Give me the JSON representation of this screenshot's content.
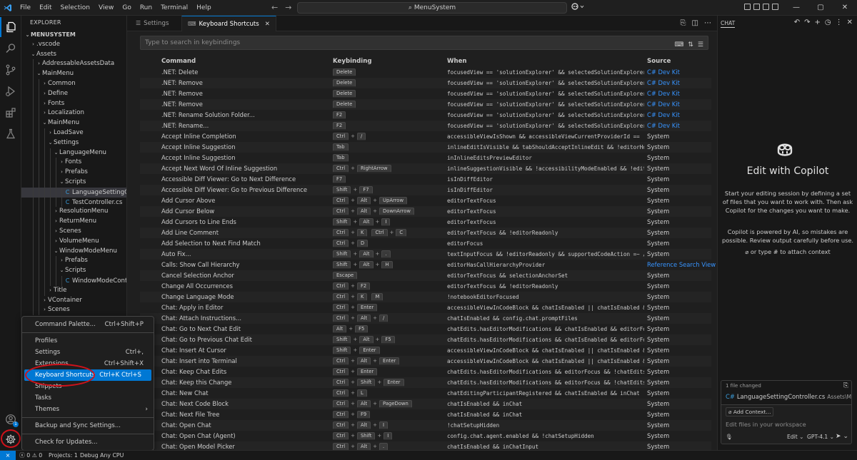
{
  "titlebar": {
    "menus": [
      "File",
      "Edit",
      "Selection",
      "View",
      "Go",
      "Run",
      "Terminal",
      "Help"
    ],
    "search": "MenuSystem",
    "icons": [
      "vscode-logo-icon",
      "back-arrow-icon",
      "forward-arrow-icon",
      "search-icon",
      "copilot-icon",
      "layout-icons",
      "minimize-icon",
      "maximize-icon",
      "close-icon"
    ]
  },
  "explorer": {
    "title": "EXPLORER",
    "tree": [
      {
        "label": "MENUSYSTEM",
        "depth": 0,
        "expanded": true,
        "bold": true
      },
      {
        "label": ".vscode",
        "depth": 1,
        "expanded": false
      },
      {
        "label": "Assets",
        "depth": 1,
        "expanded": true
      },
      {
        "label": "AddressableAssetsData",
        "depth": 2,
        "expanded": false
      },
      {
        "label": "MainMenu",
        "depth": 2,
        "expanded": true
      },
      {
        "label": "Common",
        "depth": 3,
        "expanded": false
      },
      {
        "label": "Define",
        "depth": 3,
        "expanded": false
      },
      {
        "label": "Fonts",
        "depth": 3,
        "expanded": false
      },
      {
        "label": "Localization",
        "depth": 3,
        "expanded": false
      },
      {
        "label": "MainMenu",
        "depth": 3,
        "expanded": true
      },
      {
        "label": "LoadSave",
        "depth": 4,
        "expanded": false
      },
      {
        "label": "Settings",
        "depth": 4,
        "expanded": true
      },
      {
        "label": "LanguageMenu",
        "depth": 5,
        "expanded": true
      },
      {
        "label": "Fonts",
        "depth": 6,
        "expanded": false
      },
      {
        "label": "Prefabs",
        "depth": 6,
        "expanded": false
      },
      {
        "label": "Scripts",
        "depth": 6,
        "expanded": true
      },
      {
        "label": "LanguageSettingControll...",
        "depth": 7,
        "file": true,
        "selected": true
      },
      {
        "label": "TestController.cs",
        "depth": 7,
        "file": true
      },
      {
        "label": "ResolutionMenu",
        "depth": 5,
        "expanded": false
      },
      {
        "label": "ReturnMenu",
        "depth": 5,
        "expanded": false
      },
      {
        "label": "Scenes",
        "depth": 5,
        "expanded": false
      },
      {
        "label": "VolumeMenu",
        "depth": 5,
        "expanded": false
      },
      {
        "label": "WindowModeMenu",
        "depth": 5,
        "expanded": true
      },
      {
        "label": "Prefabs",
        "depth": 6,
        "expanded": false
      },
      {
        "label": "Scripts",
        "depth": 6,
        "expanded": true
      },
      {
        "label": "WindowModeController.cs",
        "depth": 7,
        "file": true
      },
      {
        "label": "Title",
        "depth": 4,
        "expanded": false
      },
      {
        "label": "VContainer",
        "depth": 3,
        "expanded": false
      },
      {
        "label": "Scenes",
        "depth": 3,
        "expanded": false
      }
    ]
  },
  "tabs": {
    "settings": "Settings",
    "keyboard_shortcuts": "Keyboard Shortcuts",
    "close": "✕"
  },
  "keybindings": {
    "search_placeholder": "Type to search in keybindings",
    "headers": {
      "command": "Command",
      "keybinding": "Keybinding",
      "when": "When",
      "source": "Source"
    },
    "rows": [
      {
        "command": ".NET: Delete",
        "keys": [
          [
            "Delete"
          ]
        ],
        "when": "focusedView == 'solutionExplorer' && selectedSolutionExplorerNodeTy...",
        "source": "C# Dev Kit",
        "link": true
      },
      {
        "command": ".NET: Remove",
        "keys": [
          [
            "Delete"
          ]
        ],
        "when": "focusedView == 'solutionExplorer' && selectedSolutionExplorerNodeTy...",
        "source": "C# Dev Kit",
        "link": true
      },
      {
        "command": ".NET: Remove",
        "keys": [
          [
            "Delete"
          ]
        ],
        "when": "focusedView == 'solutionExplorer' && selectedSolutionExplorerNodeTy...",
        "source": "C# Dev Kit",
        "link": true
      },
      {
        "command": ".NET: Remove",
        "keys": [
          [
            "Delete"
          ]
        ],
        "when": "focusedView == 'solutionExplorer' && selectedSolutionExplorerNodeTy...",
        "source": "C# Dev Kit",
        "link": true
      },
      {
        "command": ".NET: Rename Solution Folder...",
        "keys": [
          [
            "F2"
          ]
        ],
        "when": "focusedView == 'solutionExplorer' && selectedSolutionExplorerNodeTy...",
        "source": "C# Dev Kit",
        "link": true
      },
      {
        "command": ".NET: Rename...",
        "keys": [
          [
            "F2"
          ]
        ],
        "when": "focusedView == 'solutionExplorer' && selectedSolutionExplorerNodeTy...",
        "source": "C# Dev Kit",
        "link": true
      },
      {
        "command": "Accept Inline Completion",
        "keys": [
          [
            "Ctrl",
            "/"
          ]
        ],
        "when": "accessibleViewIsShown && accessibleViewCurrentProviderId == 'inline...",
        "source": "System"
      },
      {
        "command": "Accept Inline Suggestion",
        "keys": [
          [
            "Tab"
          ]
        ],
        "when": "inlineEditIsVisible && tabShouldAcceptInlineEdit && !editorHoverFoc...",
        "source": "System"
      },
      {
        "command": "Accept Inline Suggestion",
        "keys": [
          [
            "Tab"
          ]
        ],
        "when": "inInlineEditsPreviewEditor",
        "source": "System"
      },
      {
        "command": "Accept Next Word Of Inline Suggestion",
        "keys": [
          [
            "Ctrl",
            "RightArrow"
          ]
        ],
        "when": "inlineSuggestionVisible && !accessibilityModeEnabled && !editorRead...",
        "source": "System"
      },
      {
        "command": "Accessible Diff Viewer: Go to Next Difference",
        "keys": [
          [
            "F7"
          ]
        ],
        "when": "isInDiffEditor",
        "source": "System"
      },
      {
        "command": "Accessible Diff Viewer: Go to Previous Difference",
        "keys": [
          [
            "Shift",
            "F7"
          ]
        ],
        "when": "isInDiffEditor",
        "source": "System"
      },
      {
        "command": "Add Cursor Above",
        "keys": [
          [
            "Ctrl",
            "Alt",
            "UpArrow"
          ]
        ],
        "when": "editorTextFocus",
        "source": "System"
      },
      {
        "command": "Add Cursor Below",
        "keys": [
          [
            "Ctrl",
            "Alt",
            "DownArrow"
          ]
        ],
        "when": "editorTextFocus",
        "source": "System"
      },
      {
        "command": "Add Cursors to Line Ends",
        "keys": [
          [
            "Shift",
            "Alt",
            "I"
          ]
        ],
        "when": "editorTextFocus",
        "source": "System"
      },
      {
        "command": "Add Line Comment",
        "keys": [
          [
            "Ctrl",
            "K"
          ],
          [
            "Ctrl",
            "C"
          ]
        ],
        "when": "editorTextFocus && !editorReadonly",
        "source": "System"
      },
      {
        "command": "Add Selection to Next Find Match",
        "keys": [
          [
            "Ctrl",
            "D"
          ]
        ],
        "when": "editorFocus",
        "source": "System"
      },
      {
        "command": "Auto Fix...",
        "keys": [
          [
            "Shift",
            "Alt",
            "."
          ]
        ],
        "when": "textInputFocus && !editorReadonly && supportedCodeAction =~ /(\\s|^)...",
        "source": "System"
      },
      {
        "command": "Calls: Show Call Hierarchy",
        "keys": [
          [
            "Shift",
            "Alt",
            "H"
          ]
        ],
        "when": "editorHasCallHierarchyProvider",
        "source": "Reference Search View",
        "link": true
      },
      {
        "command": "Cancel Selection Anchor",
        "keys": [
          [
            "Escape"
          ]
        ],
        "when": "editorTextFocus && selectionAnchorSet",
        "source": "System"
      },
      {
        "command": "Change All Occurrences",
        "keys": [
          [
            "Ctrl",
            "F2"
          ]
        ],
        "when": "editorTextFocus && !editorReadonly",
        "source": "System"
      },
      {
        "command": "Change Language Mode",
        "keys": [
          [
            "Ctrl",
            "K"
          ],
          [
            "M"
          ]
        ],
        "when": "!notebookEditorFocused",
        "source": "System"
      },
      {
        "command": "Chat: Apply in Editor",
        "keys": [
          [
            "Ctrl",
            "Enter"
          ]
        ],
        "when": "accessibleViewInCodeBlock && chatIsEnabled || chatIsEnabled && inCha...",
        "source": "System"
      },
      {
        "command": "Chat: Attach Instructions...",
        "keys": [
          [
            "Ctrl",
            "Alt",
            "/"
          ]
        ],
        "when": "chatIsEnabled && config.chat.promptFiles",
        "source": "System"
      },
      {
        "command": "Chat: Go to Next Chat Edit",
        "keys": [
          [
            "Alt",
            "F5"
          ]
        ],
        "when": "chatEdits.hasEditorModifications && chatIsEnabled && editorFocus && ...",
        "source": "System"
      },
      {
        "command": "Chat: Go to Previous Chat Edit",
        "keys": [
          [
            "Shift",
            "Alt",
            "F5"
          ]
        ],
        "when": "chatEdits.hasEditorModifications && chatIsEnabled && editorFocus && ...",
        "source": "System"
      },
      {
        "command": "Chat: Insert At Cursor",
        "keys": [
          [
            "Shift",
            "Enter"
          ]
        ],
        "when": "accessibleViewInCodeBlock && chatIsEnabled || chatIsEnabled && inCha...",
        "source": "System"
      },
      {
        "command": "Chat: Insert into Terminal",
        "keys": [
          [
            "Ctrl",
            "Alt",
            "Enter"
          ]
        ],
        "when": "accessibleViewInCodeBlock && chatIsEnabled || chatIsEnabled && inCha...",
        "source": "System"
      },
      {
        "command": "Chat: Keep Chat Edits",
        "keys": [
          [
            "Ctrl",
            "Enter"
          ]
        ],
        "when": "chatEdits.hasEditorModifications && editorFocus && !chatEdits.isReq...",
        "source": "System"
      },
      {
        "command": "Chat: Keep this Change",
        "keys": [
          [
            "Ctrl",
            "Shift",
            "Enter"
          ]
        ],
        "when": "chatEdits.hasEditorModifications && editorFocus && !chatEdits.isReq...",
        "source": "System"
      },
      {
        "command": "Chat: New Chat",
        "keys": [
          [
            "Ctrl",
            "L"
          ]
        ],
        "when": "chatEditingParticipantRegistered && chatIsEnabled && inChat",
        "source": "System"
      },
      {
        "command": "Chat: Next Code Block",
        "keys": [
          [
            "Ctrl",
            "Alt",
            "PageDown"
          ]
        ],
        "when": "chatIsEnabled && inChat",
        "source": "System"
      },
      {
        "command": "Chat: Next File Tree",
        "keys": [
          [
            "Ctrl",
            "F9"
          ]
        ],
        "when": "chatIsEnabled && inChat",
        "source": "System"
      },
      {
        "command": "Chat: Open Chat",
        "keys": [
          [
            "Ctrl",
            "Alt",
            "I"
          ]
        ],
        "when": "!chatSetupHidden",
        "source": "System"
      },
      {
        "command": "Chat: Open Chat (Agent)",
        "keys": [
          [
            "Ctrl",
            "Shift",
            "I"
          ]
        ],
        "when": "config.chat.agent.enabled && !chatSetupHidden",
        "source": "System"
      },
      {
        "command": "Chat: Open Model Picker",
        "keys": [
          [
            "Ctrl",
            "Alt",
            "."
          ]
        ],
        "when": "chatIsEnabled && inChatInput",
        "source": "System"
      }
    ]
  },
  "manage_menu": {
    "items": [
      {
        "label": "Command Palette...",
        "shortcut": "Ctrl+Shift+P"
      },
      {
        "separator": true
      },
      {
        "label": "Profiles",
        "shortcut": ""
      },
      {
        "label": "Settings",
        "shortcut": "Ctrl+,"
      },
      {
        "label": "Extensions",
        "shortcut": "Ctrl+Shift+X"
      },
      {
        "label": "Keyboard Shortcuts",
        "shortcut": "Ctrl+K Ctrl+S",
        "active": true
      },
      {
        "label": "Snippets",
        "shortcut": ""
      },
      {
        "label": "Tasks",
        "shortcut": ""
      },
      {
        "label": "Themes",
        "shortcut": "",
        "submenu": true
      },
      {
        "separator": true
      },
      {
        "label": "Backup and Sync Settings...",
        "shortcut": ""
      },
      {
        "separator": true
      },
      {
        "label": "Check for Updates...",
        "shortcut": ""
      }
    ]
  },
  "chat": {
    "title": "CHAT",
    "heading": "Edit with Copilot",
    "description": "Start your editing session by defining a set of files that you want to work with. Then ask Copilot for the changes you want to make.",
    "note": "Copilot is powered by AI, so mistakes are possible. Review output carefully before use.",
    "attach_hint": "or type # to attach context",
    "files_changed": "1 file changed",
    "file_name": "LanguageSettingController.cs",
    "file_path": "Assets\\Main...",
    "add_context": "Add Context...",
    "input_placeholder": "Edit files in your workspace",
    "mode": "Edit",
    "model": "GPT-4.1"
  },
  "statusbar": {
    "problems": "0",
    "warnings": "0",
    "projects": "Projects: 1",
    "debug": "Debug Any CPU"
  },
  "accounts_badge": "1",
  "colors": {
    "accent": "#0078d4",
    "link": "#3794ff",
    "annotation": "#d0121a"
  }
}
